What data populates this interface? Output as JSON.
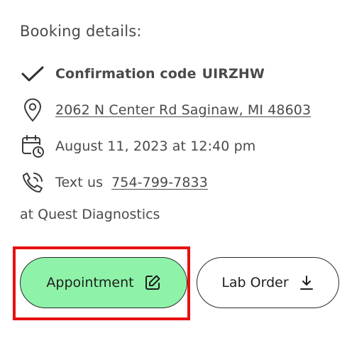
{
  "booking": {
    "heading": "Booking details:",
    "confirmation": {
      "label": "Confirmation code",
      "code": "UIRZHW",
      "icon": "check-icon"
    },
    "address": {
      "text": "2062 N Center Rd Saginaw, MI 48603",
      "icon": "location-pin-icon"
    },
    "datetime": {
      "text": "August 11, 2023 at 12:40 pm",
      "icon": "calendar-clock-icon"
    },
    "contact": {
      "prefix": "Text us",
      "phone": "754-799-7833",
      "icon": "phone-icon"
    },
    "location": "at Quest Diagnostics"
  },
  "actions": {
    "appointment_label": "Appointment",
    "appointment_icon": "edit-icon",
    "lab_order_label": "Lab Order",
    "lab_order_icon": "download-icon"
  },
  "colors": {
    "appointment_bg": "#8ef3a8",
    "highlight": "#e81010",
    "text": "#4a4a4a"
  }
}
